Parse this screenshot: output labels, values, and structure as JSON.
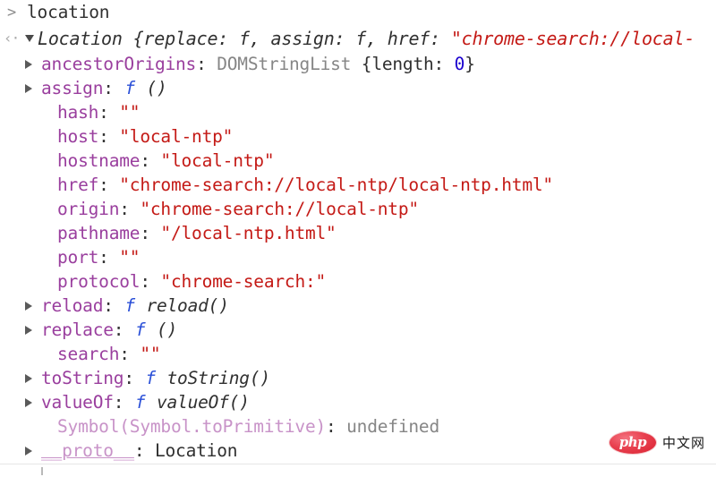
{
  "console": {
    "prompt_glyph": ">",
    "result_glyph": "‹·",
    "command": "location",
    "header": {
      "constructor": "Location",
      "preview": " {replace: f, assign: f, href: ",
      "preview_string": "\"chrome-search://local-",
      "expanded": true
    },
    "properties": [
      {
        "key": "ancestorOrigins",
        "expandable": true,
        "value_type": "object",
        "value_class": "DOMStringList",
        "value_brace_open": " {length: ",
        "value_number": "0",
        "value_brace_close": "}"
      },
      {
        "key": "assign",
        "expandable": true,
        "value_type": "function",
        "value_f": "f",
        "value_name": "()"
      },
      {
        "key": "hash",
        "expandable": false,
        "value_type": "string",
        "value_string": "\"\""
      },
      {
        "key": "host",
        "expandable": false,
        "value_type": "string",
        "value_string": "\"local-ntp\""
      },
      {
        "key": "hostname",
        "expandable": false,
        "value_type": "string",
        "value_string": "\"local-ntp\""
      },
      {
        "key": "href",
        "expandable": false,
        "value_type": "string",
        "value_string": "\"chrome-search://local-ntp/local-ntp.html\""
      },
      {
        "key": "origin",
        "expandable": false,
        "value_type": "string",
        "value_string": "\"chrome-search://local-ntp\""
      },
      {
        "key": "pathname",
        "expandable": false,
        "value_type": "string",
        "value_string": "\"/local-ntp.html\""
      },
      {
        "key": "port",
        "expandable": false,
        "value_type": "string",
        "value_string": "\"\""
      },
      {
        "key": "protocol",
        "expandable": false,
        "value_type": "string",
        "value_string": "\"chrome-search:\""
      },
      {
        "key": "reload",
        "expandable": true,
        "value_type": "function",
        "value_f": "f",
        "value_name": "reload()"
      },
      {
        "key": "replace",
        "expandable": true,
        "value_type": "function",
        "value_f": "f",
        "value_name": "()"
      },
      {
        "key": "search",
        "expandable": false,
        "value_type": "string",
        "value_string": "\"\""
      },
      {
        "key": "toString",
        "expandable": true,
        "value_type": "function",
        "value_f": "f",
        "value_name": "toString()"
      },
      {
        "key": "valueOf",
        "expandable": true,
        "value_type": "function",
        "value_f": "f",
        "value_name": "valueOf()"
      },
      {
        "key": "Symbol(Symbol.toPrimitive)",
        "key_style": "symbol",
        "expandable": false,
        "value_type": "undefined",
        "value_plain": "undefined"
      },
      {
        "key": "__proto__",
        "key_style": "proto",
        "expandable": true,
        "value_type": "plain",
        "value_plain": "Location"
      }
    ]
  },
  "watermark": {
    "logo_text": "php",
    "label": "中文网",
    "logo_color": "#d9202f"
  },
  "colors": {
    "key": "#9a3f9e",
    "string": "#c41a16",
    "number": "#1c00cf",
    "function_f": "#2a4fd7",
    "grey": "#868686",
    "text": "#303030",
    "background": "#ffffff"
  }
}
